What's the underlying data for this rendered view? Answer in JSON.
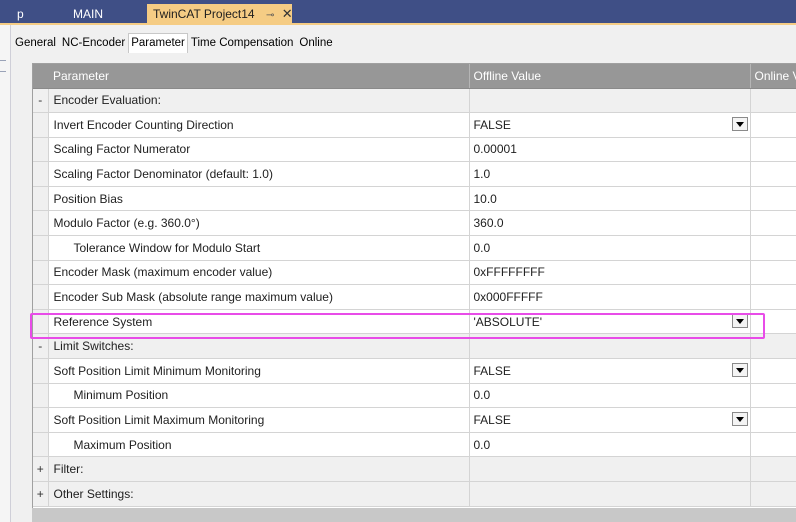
{
  "doc_tabs": [
    {
      "label": "p"
    },
    {
      "label": "MAIN"
    },
    {
      "label": "TwinCAT Project14",
      "pin": "⊸",
      "close": "✕"
    }
  ],
  "prop_tabs": [
    "General",
    "NC-Encoder",
    "Parameter",
    "Time Compensation",
    "Online"
  ],
  "grid": {
    "headers": {
      "parameter": "Parameter",
      "offline": "Offline Value",
      "online": "Online V"
    },
    "rows": [
      {
        "type": "group",
        "exp": "-",
        "name": "Encoder Evaluation:"
      },
      {
        "type": "param",
        "name": "Invert Encoder Counting Direction",
        "value": "FALSE",
        "dropdown": true
      },
      {
        "type": "param",
        "name": "Scaling Factor Numerator",
        "value": "0.00001"
      },
      {
        "type": "param",
        "name": "Scaling Factor Denominator (default: 1.0)",
        "value": "1.0"
      },
      {
        "type": "param",
        "name": "Position Bias",
        "value": "10.0"
      },
      {
        "type": "param",
        "name": "Modulo Factor (e.g. 360.0°)",
        "value": "360.0"
      },
      {
        "type": "param",
        "name": "Tolerance Window for Modulo Start",
        "value": "0.0",
        "indent": true
      },
      {
        "type": "param",
        "name": "Encoder Mask (maximum encoder value)",
        "value": "0xFFFFFFFF"
      },
      {
        "type": "param",
        "name": "Encoder Sub Mask (absolute range maximum value)",
        "value": "0x000FFFFF"
      },
      {
        "type": "param",
        "name": "Reference System",
        "value": "'ABSOLUTE'",
        "dropdown": true
      },
      {
        "type": "group",
        "exp": "-",
        "name": "Limit Switches:"
      },
      {
        "type": "param",
        "name": "Soft Position Limit Minimum Monitoring",
        "value": "FALSE",
        "dropdown": true
      },
      {
        "type": "param",
        "name": "Minimum Position",
        "value": "0.0",
        "indent": true
      },
      {
        "type": "param",
        "name": "Soft Position Limit Maximum Monitoring",
        "value": "FALSE",
        "dropdown": true
      },
      {
        "type": "param",
        "name": "Maximum Position",
        "value": "0.0",
        "indent": true
      },
      {
        "type": "group",
        "exp": "+",
        "name": "Filter:"
      },
      {
        "type": "group",
        "exp": "+",
        "name": "Other Settings:"
      }
    ]
  },
  "highlight_color": "#e84ce8"
}
